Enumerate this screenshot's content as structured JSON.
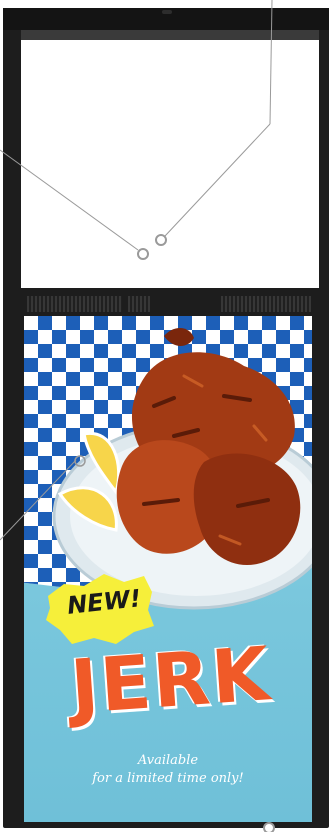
{
  "ad": {
    "badge": "NEW!",
    "product": "JERK",
    "tagline_line1": "Available",
    "tagline_line2": "for a limited time only!"
  },
  "colors": {
    "kiosk_frame": "#1d1d1d",
    "checker_blue": "#1d5fb8",
    "sky_blue": "#7fc9dc",
    "headline_orange": "#f05a28",
    "badge_yellow": "#f6ef3a"
  },
  "icons": [
    "chicken-image",
    "lemon-wedge-icon",
    "plate-icon",
    "callout-pin-icon"
  ]
}
